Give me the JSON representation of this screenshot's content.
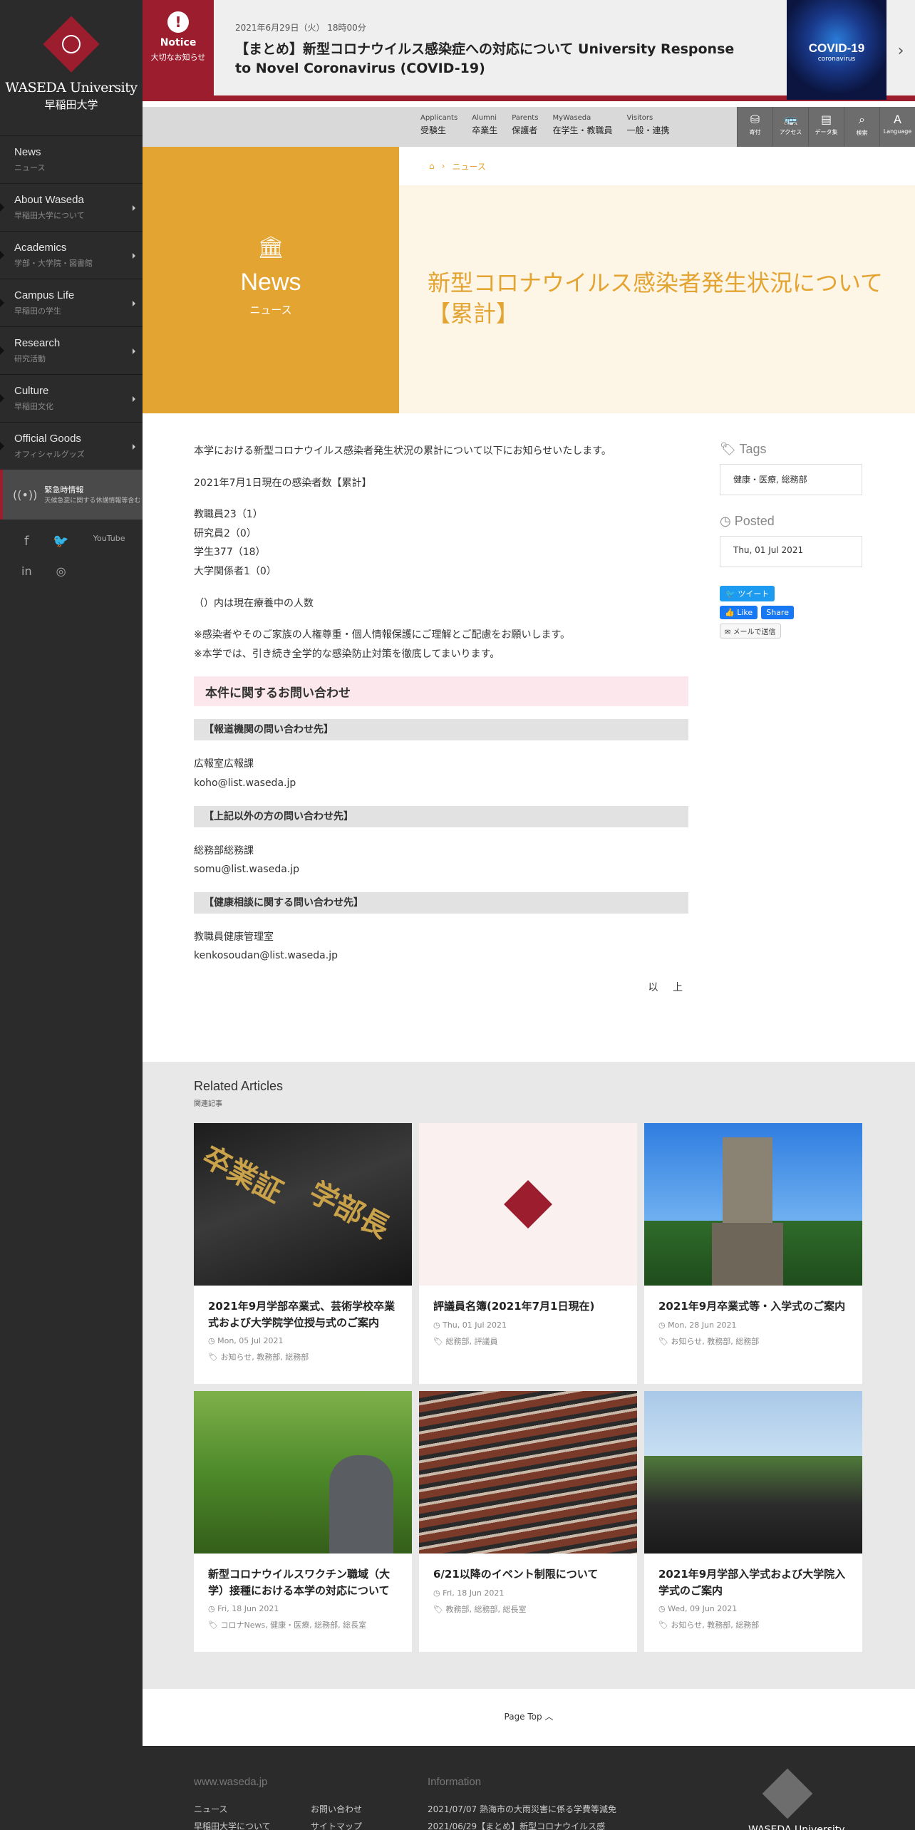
{
  "sidebar": {
    "logo_en": "WASEDA University",
    "logo_ja": "早稲田大学",
    "items": [
      {
        "en": "News",
        "ja": "ニュース",
        "has_arrow": false
      },
      {
        "en": "About Waseda",
        "ja": "早稲田大学について",
        "has_arrow": true
      },
      {
        "en": "Academics",
        "ja": "学部・大学院・図書館",
        "has_arrow": true
      },
      {
        "en": "Campus Life",
        "ja": "早稲田の学生",
        "has_arrow": true
      },
      {
        "en": "Research",
        "ja": "研究活動",
        "has_arrow": true
      },
      {
        "en": "Culture",
        "ja": "早稲田文化",
        "has_arrow": true
      },
      {
        "en": "Official Goods",
        "ja": "オフィシャルグッズ",
        "has_arrow": true
      }
    ],
    "emergency_title": "緊急時情報",
    "emergency_sub": "天候急変に関する休講情報等含む",
    "social": [
      "facebook-icon",
      "twitter-icon",
      "youtube-icon",
      "linkedin-icon",
      "instagram-icon"
    ],
    "youtube_label": "YouTube"
  },
  "notice": {
    "badge_title": "Notice",
    "badge_sub": "大切なお知らせ",
    "date": "2021年6月29日（火） 18時00分",
    "title": "【まとめ】新型コロナウイルス感染症への対応について University Response to Novel Coronavirus (COVID-19)",
    "image_text": "COVID-19",
    "image_sub": "coronavirus"
  },
  "utility": {
    "links": [
      {
        "en": "Applicants",
        "ja": "受験生"
      },
      {
        "en": "Alumni",
        "ja": "卒業生"
      },
      {
        "en": "Parents",
        "ja": "保護者"
      },
      {
        "en": "MyWaseda",
        "ja": "在学生・教職員"
      },
      {
        "en": "Visitors",
        "ja": "一般・連携"
      }
    ],
    "icons": [
      {
        "label": "寄付",
        "icon": "donate-icon"
      },
      {
        "label": "アクセス",
        "icon": "bus-icon"
      },
      {
        "label": "データ集",
        "icon": "data-icon"
      },
      {
        "label": "検索",
        "icon": "search-icon"
      },
      {
        "label": "Language",
        "icon": "language-icon"
      }
    ]
  },
  "hero": {
    "section_en": "News",
    "section_ja": "ニュース",
    "breadcrumb": "ニュース",
    "title": "新型コロナウイルス感染者発生状況について【累計】"
  },
  "article": {
    "intro": "本学における新型コロナウイルス感染者発生状況の累計について以下にお知らせいたします。",
    "as_of": "2021年7月1日現在の感染者数【累計】",
    "counts": [
      "教職員23（1）",
      "研究員2（0）",
      "学生377（18）",
      "大学関係者1（0）"
    ],
    "note": "（）内は現在療養中の人数",
    "request1": "※感染者やそのご家族の人権尊重・個人情報保護にご理解とご配慮をお願いします。",
    "request2": "※本学では、引き続き全学的な感染防止対策を徹底してまいります。",
    "inquiry_head": "本件に関するお問い合わせ",
    "contacts": [
      {
        "head": "【報道機関の問い合わせ先】",
        "org": "広報室広報課",
        "email": "koho@list.waseda.jp"
      },
      {
        "head": "【上記以外の方の問い合わせ先】",
        "org": "総務部総務課",
        "email": "somu@list.waseda.jp"
      },
      {
        "head": "【健康相談に関する問い合わせ先】",
        "org": "教職員健康管理室",
        "email": "kenkosoudan@list.waseda.jp"
      }
    ],
    "closing": "以 上"
  },
  "aside": {
    "tags_label": "Tags",
    "tags_value": "健康・医療, 総務部",
    "posted_label": "Posted",
    "posted_value": "Thu, 01 Jul 2021",
    "tweet": "ツイート",
    "like": "Like",
    "share": "Share",
    "mail": "メールで送信"
  },
  "related": {
    "title_en": "Related Articles",
    "title_ja": "関連記事",
    "cards": [
      {
        "title": "2021年9月学部卒業式、芸術学校卒業式および大学院学位授与式のご案内",
        "date": "Mon, 05 Jul 2021",
        "tags": "お知らせ, 教務部, 総務部"
      },
      {
        "title": "評議員名簿(2021年7月1日現在)",
        "date": "Thu, 01 Jul 2021",
        "tags": "総務部, 評議員"
      },
      {
        "title": "2021年9月卒業式等・入学式のご案内",
        "date": "Mon, 28 Jun 2021",
        "tags": "お知らせ, 教務部, 総務部"
      },
      {
        "title": "新型コロナウイルスワクチン職域（大学）接種における本学の対応について",
        "date": "Fri, 18 Jun 2021",
        "tags": "コロナNews, 健康・医療, 総務部, 総長室"
      },
      {
        "title": "6/21以降のイベント制限について",
        "date": "Fri, 18 Jun 2021",
        "tags": "教務部, 総務部, 総長室"
      },
      {
        "title": "2021年9月学部入学式および大学院入学式のご案内",
        "date": "Wed, 09 Jun 2021",
        "tags": "お知らせ, 教務部, 総務部"
      }
    ]
  },
  "page_top": "Page Top",
  "footer": {
    "site": "www.waseda.jp",
    "info": "Information",
    "links_col1": [
      "ニュース",
      "早稲田大学について"
    ],
    "links_col2": [
      "お問い合わせ",
      "サイトマップ"
    ],
    "info_items": [
      "2021/07/07 熱海市の大雨災害に係る学費等減免",
      "2021/06/29【まとめ】新型コロナウイルス感"
    ],
    "logo_text": "WASEDA University"
  }
}
